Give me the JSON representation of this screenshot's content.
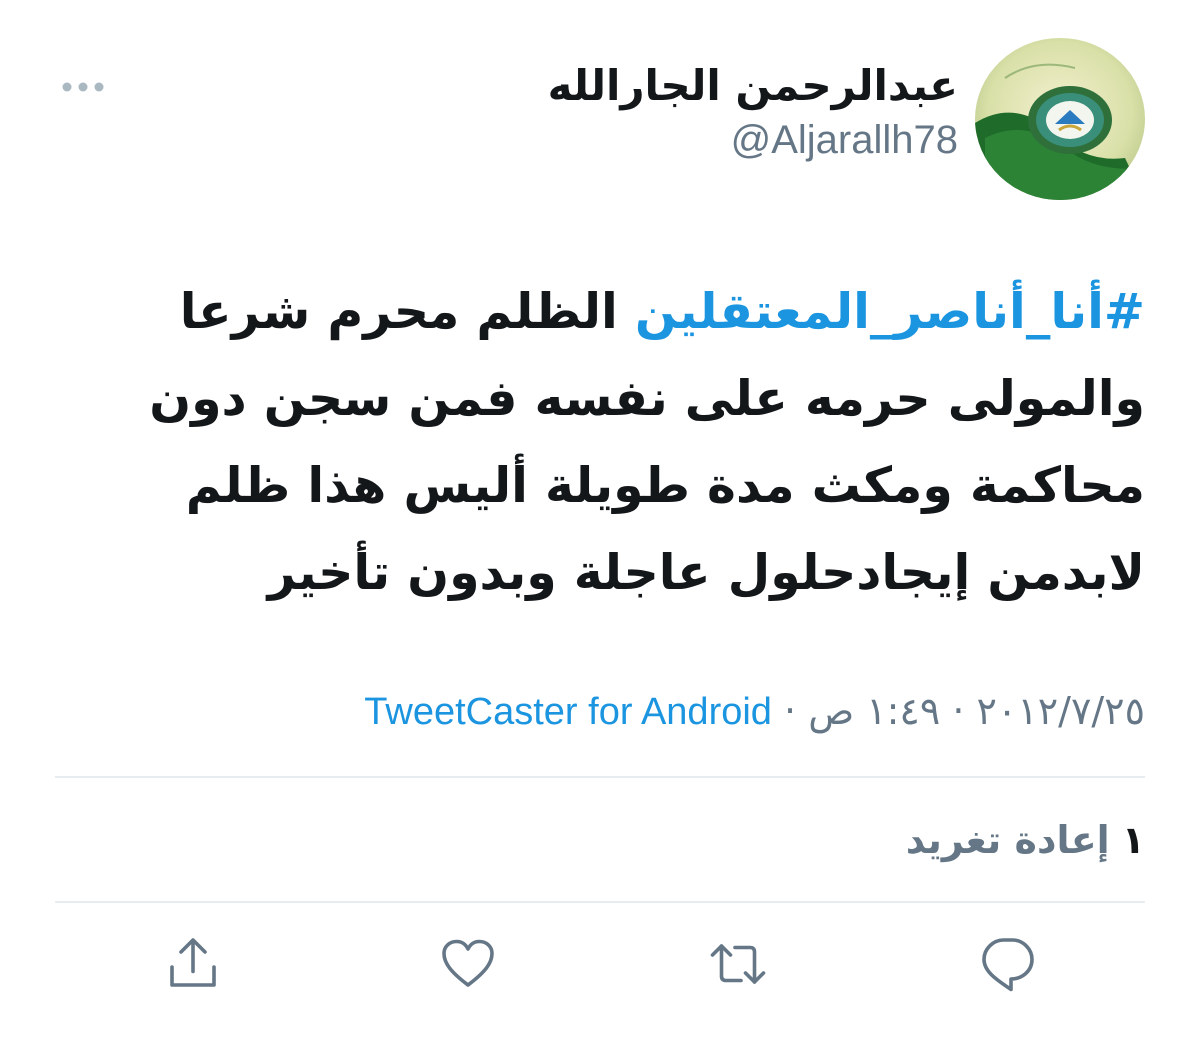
{
  "tweet": {
    "author": {
      "display_name": "عبدالرحمن الجارالله",
      "handle": "@Aljarallh78",
      "avatar_icon": "green-emblem-avatar"
    },
    "more_icon": "more-horizontal-icon",
    "hashtag": "#أنا_أناصر_المعتقلين",
    "text_parts": [
      " الظلم محرم شرعا",
      "والمولى حرمه على نفسه فمن سجن دون",
      "محاكمة ومكث مدة طويلة أليس هذا ظلم",
      "لابدمن إيجادحلول عاجلة وبدون تأخير"
    ],
    "date": "٢٠١٢/٧/٢٥",
    "time": "١:٤٩ ص",
    "separator": " · ",
    "source": "TweetCaster for Android",
    "retweet_count": "١",
    "retweet_label": "إعادة تغريد"
  },
  "actions": [
    {
      "name": "share",
      "icon": "share-icon"
    },
    {
      "name": "like",
      "icon": "heart-icon"
    },
    {
      "name": "retweet",
      "icon": "retweet-icon"
    },
    {
      "name": "reply",
      "icon": "reply-icon"
    }
  ],
  "colors": {
    "link": "#1b95e0",
    "text": "#14171a",
    "secondary": "#657786",
    "divider": "#e6ecf0"
  }
}
